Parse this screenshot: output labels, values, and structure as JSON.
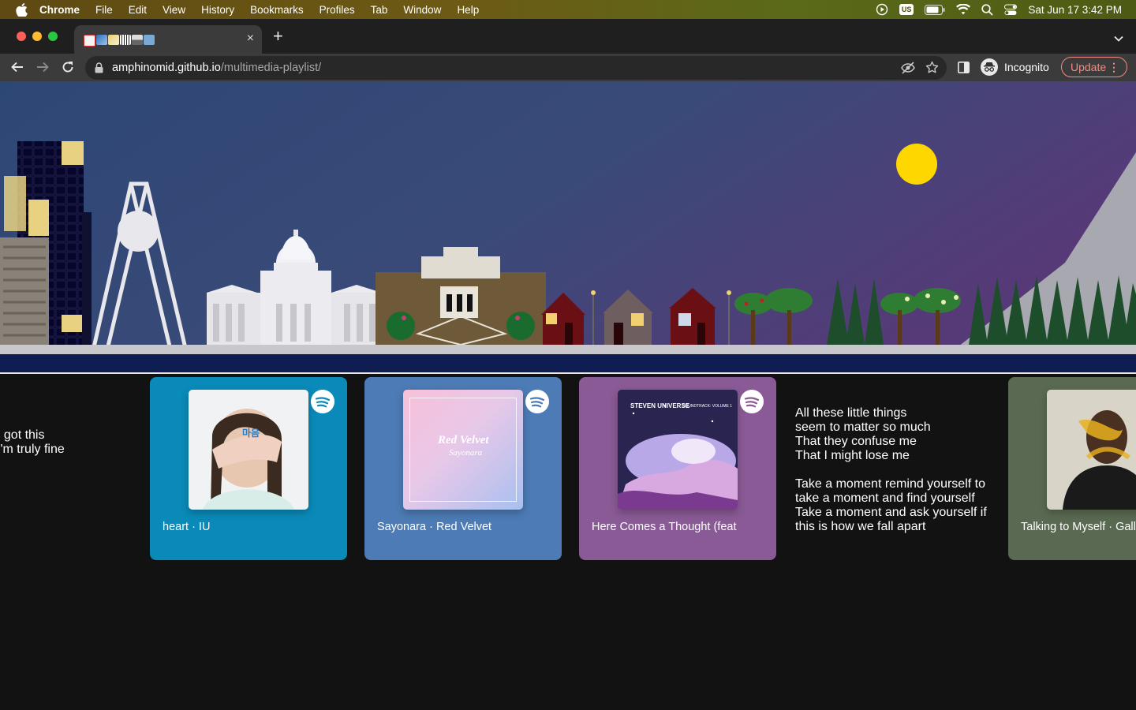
{
  "menubar": {
    "items": [
      "Chrome",
      "File",
      "Edit",
      "View",
      "History",
      "Bookmarks",
      "Profiles",
      "Tab",
      "Window",
      "Help"
    ],
    "input_source": "US",
    "datetime": "Sat Jun 17  3:42 PM"
  },
  "tab": {
    "close_label": "×"
  },
  "toolbar": {
    "url_host": "amphinomid.github.io",
    "url_path": "/multimedia-playlist/",
    "profile_label": "Incognito",
    "update_label": "Update",
    "menu_dots": "⋮"
  },
  "lyrics_left": [
    "I got this",
    "I'm truly fine"
  ],
  "lyrics_right": [
    "All these little things",
    "seem to matter so much",
    "That they confuse me",
    "That I might lose me",
    "",
    "Take a moment remind yourself to",
    "take a moment and find yourself",
    "Take a moment and ask yourself if",
    "this is how we fall apart"
  ],
  "cards": [
    {
      "title": "heart · IU",
      "bg": "#0a8ab8",
      "art_caption": "마음"
    },
    {
      "title": "Sayonara · Red Velvet",
      "bg": "#4c7bb5",
      "art_caption": "Red Velvet",
      "art_subcaption": "Sayonara"
    },
    {
      "title": "Here Comes a Thought (feat",
      "bg": "#8a5a96",
      "art_caption": "STEVEN UNIVERSE",
      "art_subcaption": "SOUNDTRACK: VOLUME 1"
    },
    {
      "title": "Talking to Myself · Gallant",
      "bg": "#5a6a52"
    }
  ],
  "colors": {
    "spotify": "#ffffff",
    "update": "#f28b82",
    "moon": "#ffd700",
    "sky_top": "#2e4a74",
    "sky_right": "#553a78",
    "ground": "#0f1d52"
  }
}
